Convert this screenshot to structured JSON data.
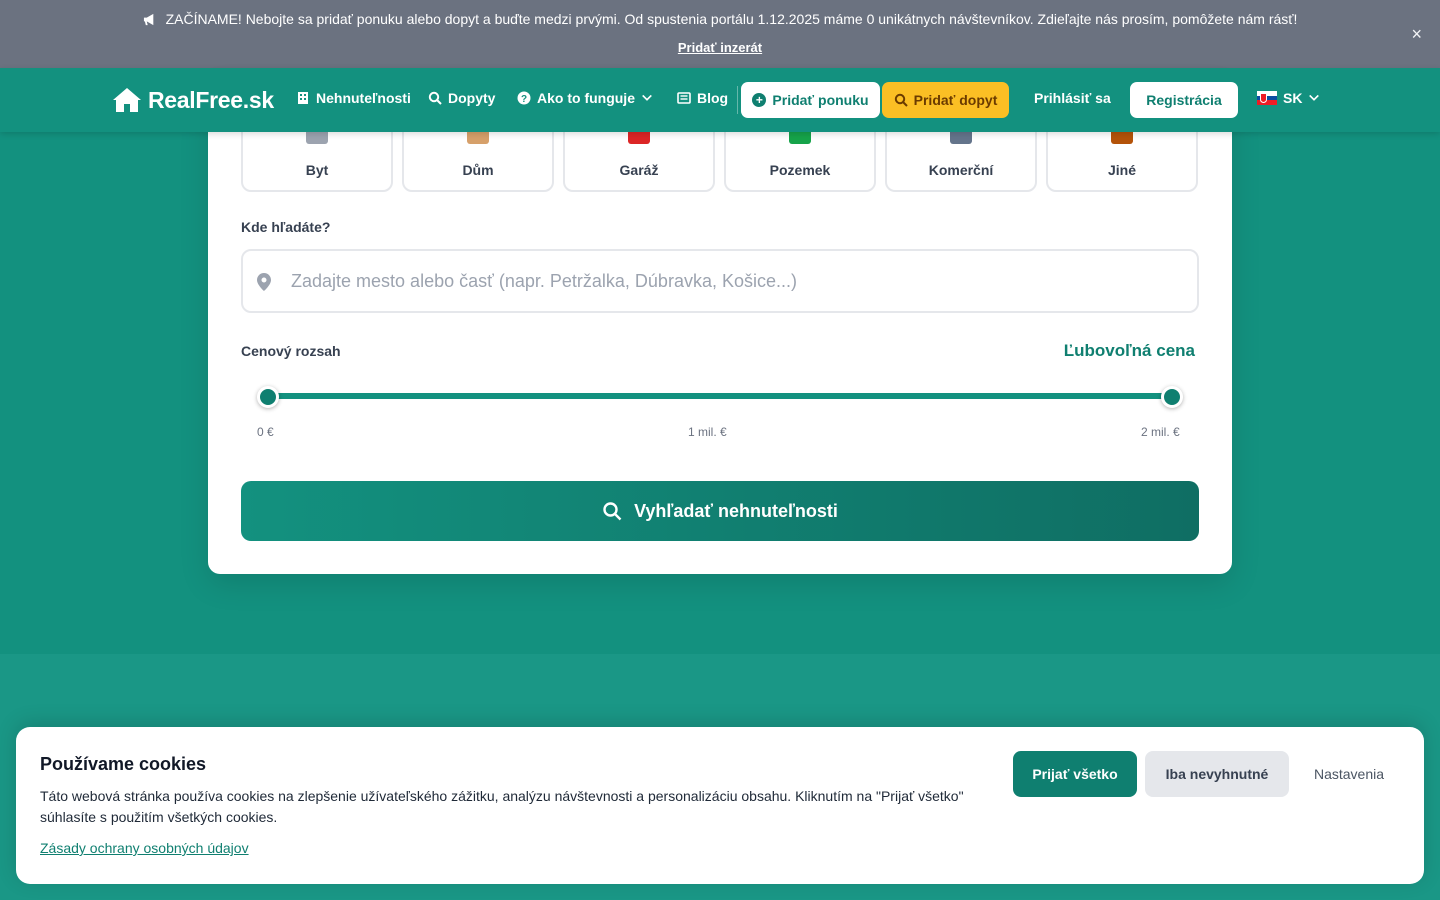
{
  "announcement": {
    "message": "ZAČÍNAME! Nebojte sa pridať ponuku alebo dopyt a buďte medzi prvými. Od spustenia portálu 1.12.2025 máme 0 unikátnych návštevníkov. Zdieľajte nás prosím, pomôžete nám rásť!",
    "cta": "Pridať inzerát",
    "close": "×"
  },
  "header": {
    "logo": "RealFree.sk",
    "nav": [
      {
        "label": "Nehnuteľnosti",
        "icon": "building-icon"
      },
      {
        "label": "Dopyty",
        "icon": "search-icon"
      },
      {
        "label": "Ako to funguje",
        "icon": "question-icon"
      },
      {
        "label": "Blog",
        "icon": "newspaper-icon"
      }
    ],
    "add_offer": "Pridať ponuku",
    "add_demand": "Pridať dopyt",
    "login": "Prihlásiť sa",
    "register": "Registrácia",
    "language": "SK"
  },
  "search": {
    "property_types": [
      {
        "label": "Byt",
        "icon": "apartment-icon",
        "color": "#9ca3af"
      },
      {
        "label": "Dům",
        "icon": "house-icon",
        "color": "#d6a06a"
      },
      {
        "label": "Garáž",
        "icon": "car-icon",
        "color": "#dc2626"
      },
      {
        "label": "Pozemek",
        "icon": "tree-icon",
        "color": "#16a34a"
      },
      {
        "label": "Komerční",
        "icon": "office-icon",
        "color": "#64748b"
      },
      {
        "label": "Jiné",
        "icon": "box-icon",
        "color": "#b45309"
      }
    ],
    "location_label": "Kde hľadáte?",
    "location_placeholder": "Zadajte mesto alebo časť (napr. Petržalka, Dúbravka, Košice...)",
    "location_value": "",
    "price_label": "Cenový rozsah",
    "price_value": "Ľubovoľná cena",
    "price_min_tick": "0 €",
    "price_mid_tick": "1 mil. €",
    "price_max_tick": "2 mil. €",
    "slider_min_fraction": 0,
    "slider_max_fraction": 1,
    "submit": "Vyhľadať nehnuteľnosti"
  },
  "cookies": {
    "title": "Používame cookies",
    "text": "Táto webová stránka používa cookies na zlepšenie užívateľského zážitku, analýzu návštevnosti a personalizáciu obsahu. Kliknutím na \"Prijať všetko\" súhlasíte s použitím všetkých cookies.",
    "privacy_link": "Zásady ochrany osobných údajov",
    "accept_all": "Prijať všetko",
    "necessary_only": "Iba nevyhnutné",
    "settings": "Nastavenia"
  },
  "colors": {
    "brand": "#13917f",
    "accent": "#fbbf24",
    "announcement_bg": "#6b7280"
  }
}
